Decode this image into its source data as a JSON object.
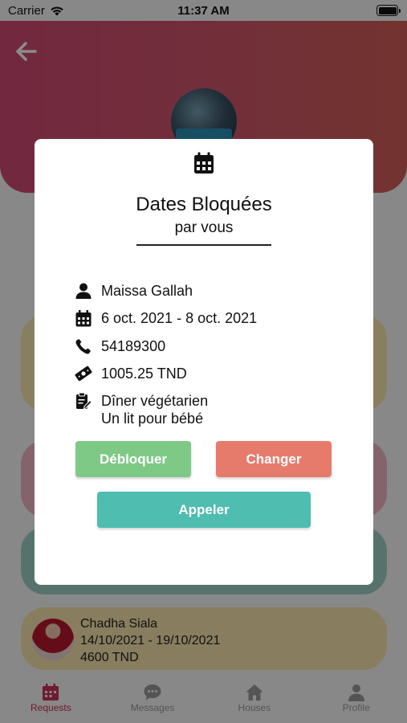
{
  "status_bar": {
    "carrier": "Carrier",
    "time": "11:37 AM",
    "battery_level": 1.0
  },
  "background": {
    "booking_preview": {
      "guest": "Chadha Siala",
      "dates": "14/10/2021 - 19/10/2021",
      "price": "4600 TND"
    },
    "tabs": [
      {
        "label": "Requests",
        "icon": "calendar-icon"
      },
      {
        "label": "Messages",
        "icon": "chat-icon"
      },
      {
        "label": "Houses",
        "icon": "house-icon"
      },
      {
        "label": "Profile",
        "icon": "person-icon"
      }
    ]
  },
  "modal": {
    "title": "Dates Bloquées",
    "subtitle": "par vous",
    "guest_name": "Maissa Gallah",
    "dates": "6 oct. 2021 - 8 oct. 2021",
    "phone": "54189300",
    "price": "1005.25 TND",
    "notes": [
      "Dîner végétarien",
      "Un lit pour bébé"
    ],
    "buttons": {
      "unblock": "Débloquer",
      "change": "Changer",
      "call": "Appeler"
    }
  },
  "colors": {
    "header_gradient_start": "#cf4a74",
    "header_gradient_end": "#cf5e58",
    "unblock_button": "#7fc987",
    "change_button": "#e67b6c",
    "call_button": "#4fbdaf",
    "active_tab": "#c8325a"
  }
}
